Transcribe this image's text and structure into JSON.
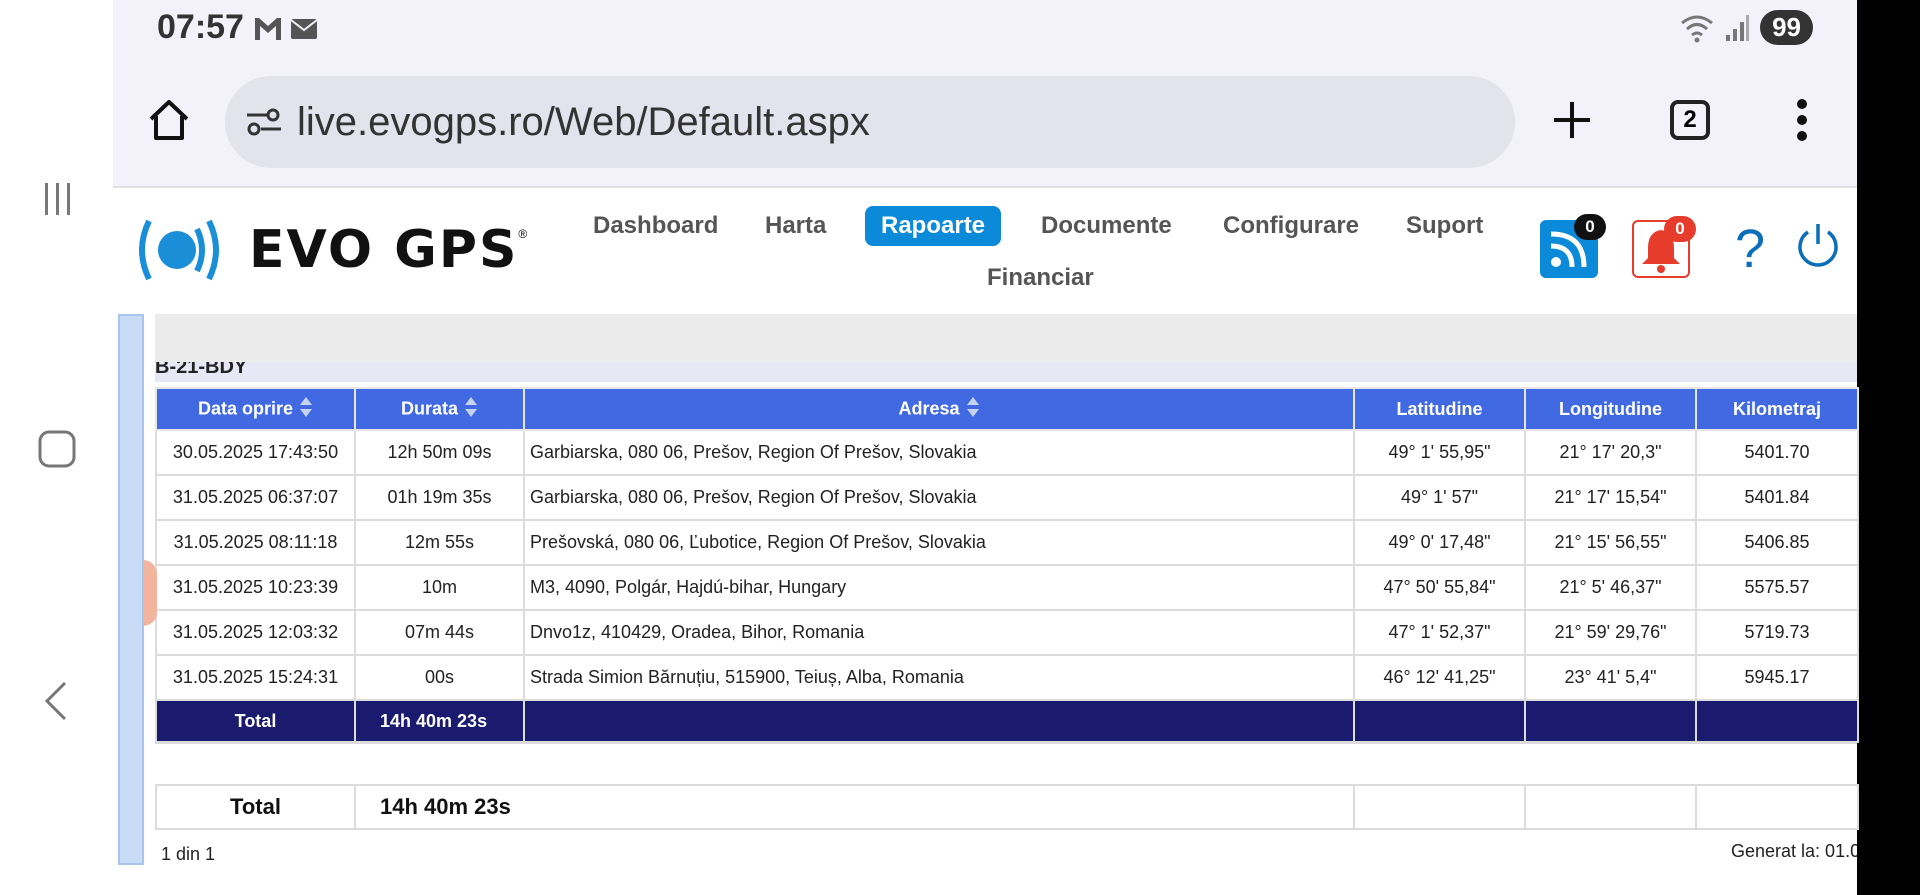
{
  "status_bar": {
    "time": "07:57",
    "battery": "99"
  },
  "browser": {
    "url": "live.evogps.ro/Web/Default.aspx",
    "tab_count": "2"
  },
  "app": {
    "logo_text": "EVO GPS",
    "logo_mark": "®",
    "menu": [
      "Dashboard",
      "Harta",
      "Rapoarte",
      "Documente",
      "Configurare",
      "Suport",
      "Financiar"
    ],
    "active_menu": "Rapoarte",
    "rss_badge": "0",
    "alert_badge": "0",
    "help_label": "?"
  },
  "report": {
    "vehicle": "B-21-BDY",
    "columns": [
      "Data oprire",
      "Durata",
      "Adresa",
      "Latitudine",
      "Longitudine",
      "Kilometraj"
    ],
    "rows": [
      [
        "30.05.2025 17:43:50",
        "12h 50m 09s",
        "Garbiarska,  080 06, Prešov, Region Of Prešov, Slovakia",
        "49° 1' 55,95\"",
        "21° 17' 20,3\"",
        "5401.70"
      ],
      [
        "31.05.2025 06:37:07",
        "01h 19m 35s",
        "Garbiarska,  080 06, Prešov, Region Of Prešov, Slovakia",
        "49° 1' 57\"",
        "21° 17' 15,54\"",
        "5401.84"
      ],
      [
        "31.05.2025 08:11:18",
        "12m 55s",
        "Prešovská,  080 06, Ľubotice, Region Of Prešov, Slovakia",
        "49° 0' 17,48\"",
        "21° 15' 56,55\"",
        "5406.85"
      ],
      [
        "31.05.2025 10:23:39",
        "10m",
        "M3,  4090, Polgár, Hajdú-bihar, Hungary",
        "47° 50' 55,84\"",
        "21° 5' 46,37\"",
        "5575.57"
      ],
      [
        "31.05.2025 12:03:32",
        "07m 44s",
        "Dnvo1z,  410429, Oradea, Bihor, Romania",
        "47° 1' 52,37\"",
        "21° 59' 29,76\"",
        "5719.73"
      ],
      [
        "31.05.2025 15:24:31",
        "00s",
        "Strada Simion Bărnuțiu,  515900, Teiuș, Alba, Romania",
        "46° 12' 41,25\"",
        "23° 41' 5,4\"",
        "5945.17"
      ]
    ],
    "total_label": "Total",
    "total_duration": "14h 40m 23s",
    "grand_total_label": "Total",
    "grand_total_duration": "14h 40m 23s",
    "page_info": "1 din 1",
    "generated": "Generat la: 01.0"
  }
}
